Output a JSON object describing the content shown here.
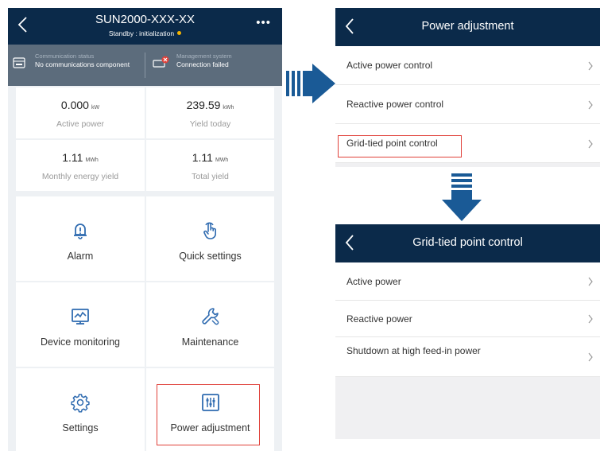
{
  "device": {
    "title": "SUN2000-XXX-XX",
    "status_text": "Standby : initialization",
    "status_dot_color": "#f5b400"
  },
  "status_bar": {
    "comm_label": "Communication status",
    "comm_value": "No communications component",
    "comm_icon": "communication-card-icon",
    "mgmt_label": "Management system",
    "mgmt_value": "Connection failed",
    "mgmt_icon": "cloud-error-icon"
  },
  "stats": [
    {
      "value": "0.000",
      "unit": "kW",
      "label": "Active power"
    },
    {
      "value": "239.59",
      "unit": "kWh",
      "label": "Yield today"
    },
    {
      "value": "1.11",
      "unit": "MWh",
      "label": "Monthly energy yield"
    },
    {
      "value": "1.11",
      "unit": "MWh",
      "label": "Total yield"
    }
  ],
  "tiles": [
    {
      "label": "Alarm",
      "icon": "bell-alert-icon"
    },
    {
      "label": "Quick settings",
      "icon": "hand-pointer-icon"
    },
    {
      "label": "Device monitoring",
      "icon": "monitor-chart-icon"
    },
    {
      "label": "Maintenance",
      "icon": "wrench-icon"
    },
    {
      "label": "Settings",
      "icon": "gear-icon"
    },
    {
      "label": "Power adjustment",
      "icon": "sliders-icon"
    }
  ],
  "power_adjustment": {
    "title": "Power adjustment",
    "items": [
      "Active power control",
      "Reactive power control",
      "Grid-tied point control"
    ]
  },
  "grid_tied": {
    "title": "Grid-tied point control",
    "items": [
      "Active power",
      "Reactive power",
      "Shutdown at high feed-in power"
    ]
  },
  "colors": {
    "header": "#0b2a4a",
    "status_bar": "#5c6c7c",
    "highlight": "#e0413a",
    "arrow": "#1a5a96",
    "icon_blue": "#2f6bb0"
  }
}
